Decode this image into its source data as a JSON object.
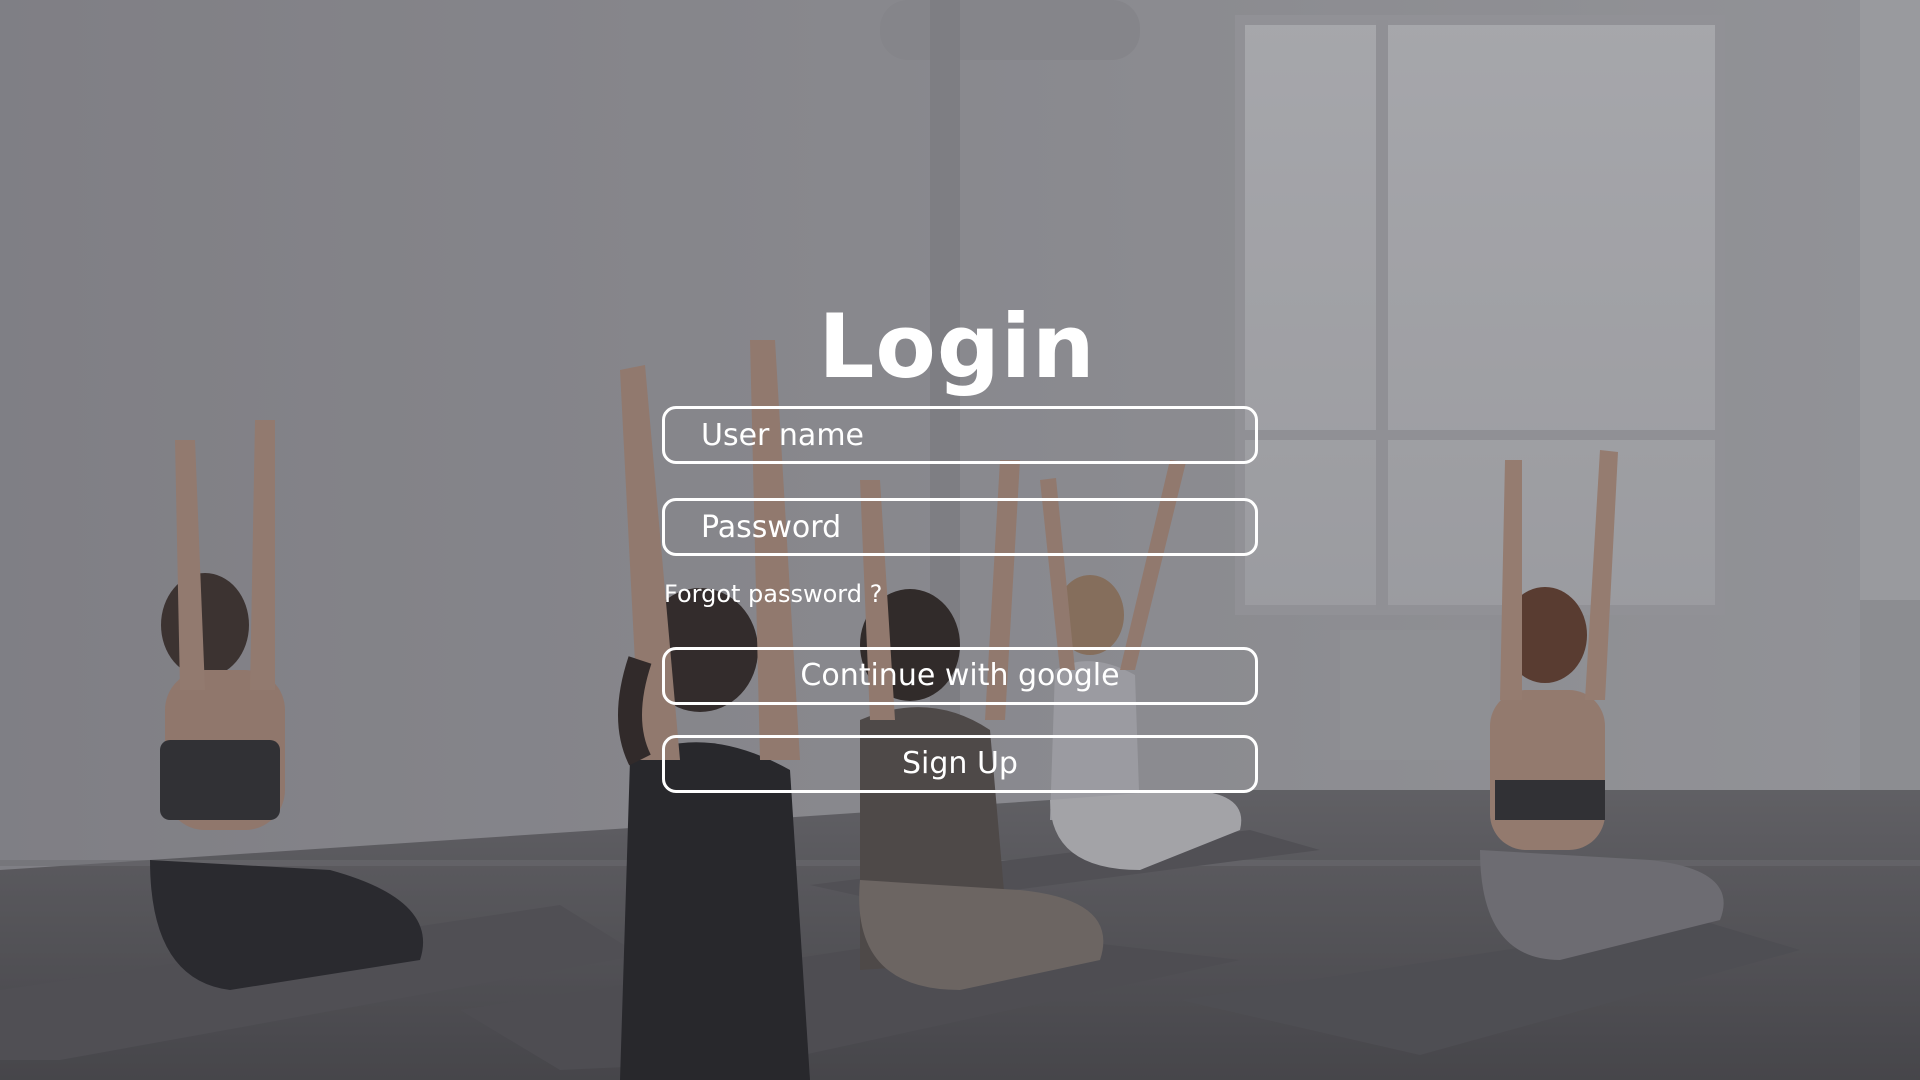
{
  "title": "Login",
  "form": {
    "username_placeholder": "User name",
    "username_value": "",
    "password_placeholder": "Password",
    "password_value": "",
    "forgot_password": "Forgot password ?",
    "google_button": "Continue with google",
    "signup_button": "Sign Up"
  },
  "colors": {
    "text": "#ffffff",
    "border": "#ffffff",
    "overlay": "#3c3c42"
  }
}
